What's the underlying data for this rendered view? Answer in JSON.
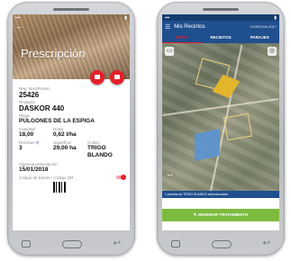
{
  "left_screen": {
    "title": "Prescripción",
    "fields": {
      "reg_label": "Reg. MAGRAMA",
      "reg_value": "25426",
      "product_label": "Producto",
      "product_value": "DASKOR 440",
      "pest_label": "Plaga",
      "pest_value": "PULGONES DE LA ESPIGA",
      "quantity_label": "Cantidad",
      "quantity_value": "18,00",
      "dose_label": "Dosis",
      "dose_value": "0,62 l/ha",
      "plots_label": "Recintos",
      "plots_value": "3",
      "surface_label": "Superficie",
      "surface_value": "29,00 ha",
      "crop_label": "Cultivo",
      "crop_value": "TRIGO BLANDO",
      "validity_label": "Vigencia prescripción",
      "validity_value": "15/01/2018",
      "barcode_label": "Código de barras / Código QR"
    }
  },
  "right_screen": {
    "title": "Mis Recintos",
    "subtitle": "COSECHA 2017",
    "tabs": [
      {
        "label": "MAPA"
      },
      {
        "label": "RECINTOS"
      },
      {
        "label": "PARAJES"
      }
    ],
    "info_text": "1 parcela de TRIGO BLANDO seleccionadas",
    "cta_label": "GENERAR TRATAMIENTO"
  },
  "colors": {
    "accent": "#e5202a",
    "primary": "#1f4f8e",
    "cta": "#7dbb3f"
  }
}
